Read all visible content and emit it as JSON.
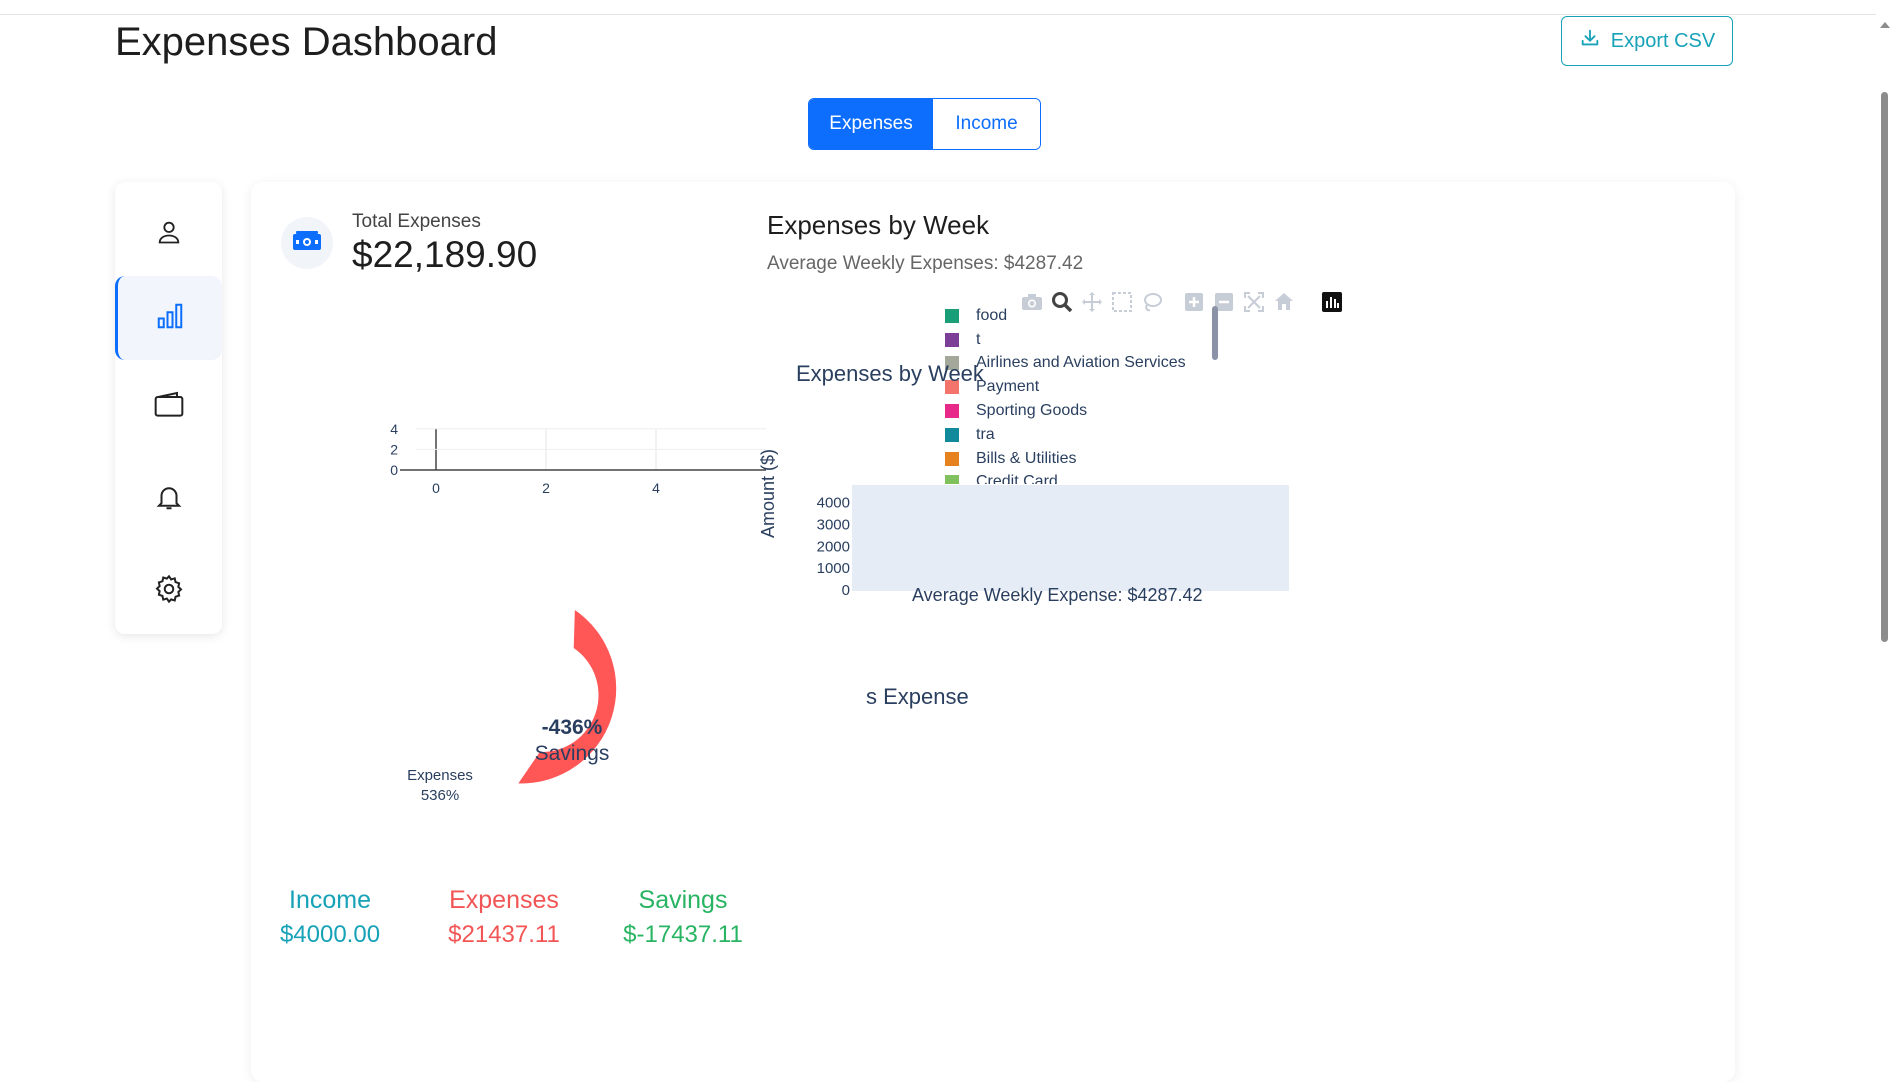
{
  "header": {
    "title": "Expenses Dashboard",
    "export_label": "Export CSV"
  },
  "toggle": {
    "expenses_label": "Expenses",
    "income_label": "Income",
    "active": "Expenses"
  },
  "sidebar": {
    "items": [
      {
        "name": "profile",
        "icon": "user-icon"
      },
      {
        "name": "analytics",
        "icon": "bar-chart-icon",
        "active": true
      },
      {
        "name": "wallet",
        "icon": "wallet-icon"
      },
      {
        "name": "notifications",
        "icon": "bell-icon"
      },
      {
        "name": "settings",
        "icon": "gear-icon"
      }
    ]
  },
  "total": {
    "label": "Total Expenses",
    "value": "$22,189.90",
    "icon": "cash-icon"
  },
  "weekly": {
    "title": "Expenses by Week",
    "average_text": "Average Weekly Expenses: $4287.42",
    "plot_title": "Expenses by Week",
    "annotation": "Average Weekly Expense: $4287.42",
    "y_axis_title": "Amount ($)",
    "legend": [
      {
        "label": "food",
        "color": "#1a9e77"
      },
      {
        "label": "t",
        "color": "#7b3f98"
      },
      {
        "label": "Airlines and Aviation Services",
        "color": "#a3a89a"
      },
      {
        "label": "Payment",
        "color": "#f2746b"
      },
      {
        "label": "Sporting Goods",
        "color": "#e7298a"
      },
      {
        "label": "tra",
        "color": "#118a9b"
      },
      {
        "label": "Bills & Utilities",
        "color": "#e6821e"
      },
      {
        "label": "Credit Card",
        "color": "#7fc15d"
      }
    ],
    "second_plot_title": "s Expense"
  },
  "chart_data": [
    {
      "type": "line",
      "title": "",
      "x_ticks": [
        "0",
        "2",
        "4"
      ],
      "y_ticks": [
        "0",
        "2",
        "4"
      ],
      "series": []
    },
    {
      "type": "bar",
      "title": "Expenses by Week",
      "ylabel": "Amount ($)",
      "y_ticks": [
        "0",
        "1000",
        "2000",
        "3000",
        "4000"
      ],
      "ylim": [
        0,
        4400
      ],
      "annotation": "Average Weekly Expense: $4287.42",
      "series": []
    },
    {
      "type": "pie",
      "title": "",
      "center_value": "-436%",
      "center_label": "Savings",
      "slices": [
        {
          "label": "Expenses",
          "pct_label": "536%",
          "color": "#ff5656"
        }
      ]
    }
  ],
  "summary": {
    "income": {
      "label": "Income",
      "value": "$4000.00",
      "color": "#17a2b8"
    },
    "expenses": {
      "label": "Expenses",
      "value": "$21437.11",
      "color": "#f25555"
    },
    "savings": {
      "label": "Savings",
      "value": "$-17437.11",
      "color": "#28b463"
    }
  },
  "colors": {
    "primary": "#0d6efd",
    "info": "#17a2b8",
    "plot_bg": "#e5ecf6",
    "plot_text": "#2a3f5f"
  }
}
